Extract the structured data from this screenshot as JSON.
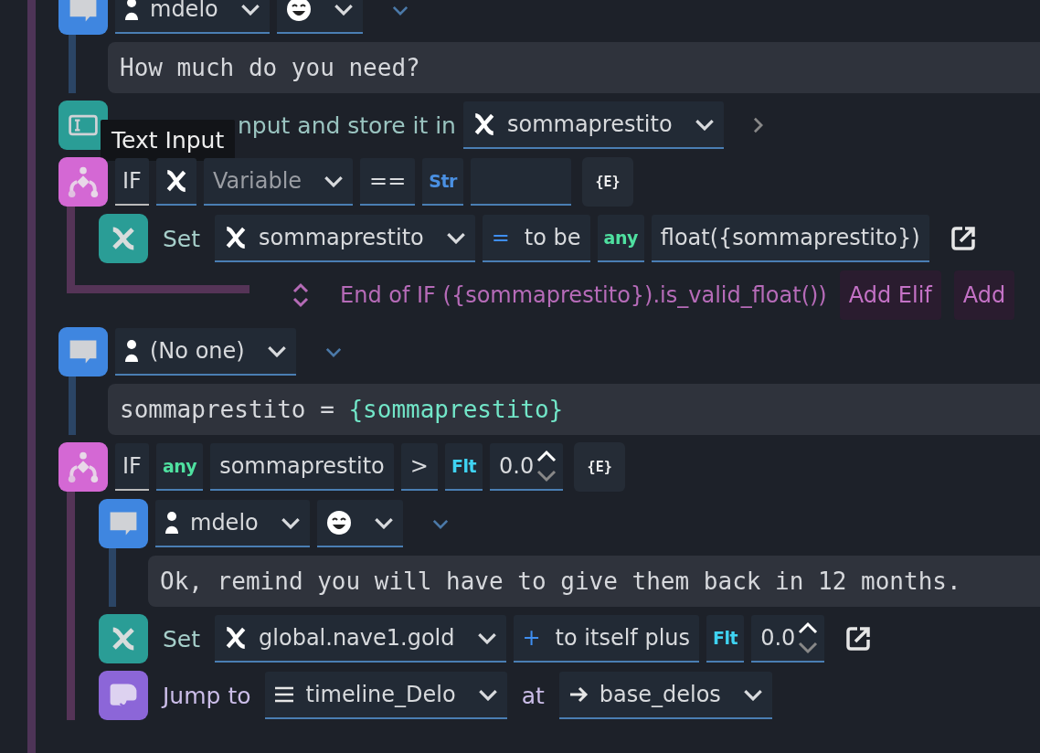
{
  "timeline": [
    {
      "kind": "text",
      "character": "mdelo",
      "portrait": true,
      "expand": true,
      "text": [
        {
          "kind": "plain",
          "text": "How much do you need?"
        }
      ]
    },
    {
      "kind": "input",
      "label": "nput and store it in",
      "variable": "sommaprestito",
      "tooltip": "Text Input"
    },
    {
      "kind": "condition",
      "keyword": "IF",
      "left": {
        "kind": "variable",
        "value": "Variable",
        "unset": true
      },
      "operator": "==",
      "right": {
        "kind": "string",
        "type_label": "Str"
      },
      "expression_button": "{E}",
      "children": [
        {
          "kind": "set",
          "label": "Set",
          "variable": "sommaprestito",
          "operator": {
            "symbol": "=",
            "label": "to be"
          },
          "value": {
            "kind": "any",
            "type_label": "any",
            "value": "float({sommaprestito})"
          }
        }
      ],
      "end": {
        "label": "End of IF ({sommaprestito}).is_valid_float())",
        "buttons": [
          "Add Elif",
          "Add"
        ]
      }
    },
    {
      "kind": "text",
      "character": "(No one)",
      "portrait": false,
      "expand": true,
      "text": [
        {
          "kind": "plain",
          "text": "sommaprestito = "
        },
        {
          "kind": "variable",
          "text": "{sommaprestito}"
        }
      ]
    },
    {
      "kind": "condition",
      "keyword": "IF",
      "left": {
        "kind": "any",
        "type_label": "any",
        "value": "sommaprestito"
      },
      "operator": ">",
      "right": {
        "kind": "float",
        "type_label": "Flt",
        "value": "0.0"
      },
      "expression_button": "{E}",
      "children": [
        {
          "kind": "text",
          "character": "mdelo",
          "portrait": true,
          "expand": true,
          "text": [
            {
              "kind": "plain",
              "text": "Ok, remind you will have to give them back in 12 months."
            }
          ]
        },
        {
          "kind": "set",
          "label": "Set",
          "variable": "global.nave1.gold",
          "operator": {
            "symbol": "+",
            "label": "to itself plus"
          },
          "value": {
            "kind": "float",
            "type_label": "Flt",
            "value": "0.0"
          }
        },
        {
          "kind": "jump",
          "label": "Jump to",
          "timeline": "timeline_Delo",
          "at_label": "at",
          "target": "base_delos"
        }
      ]
    }
  ]
}
